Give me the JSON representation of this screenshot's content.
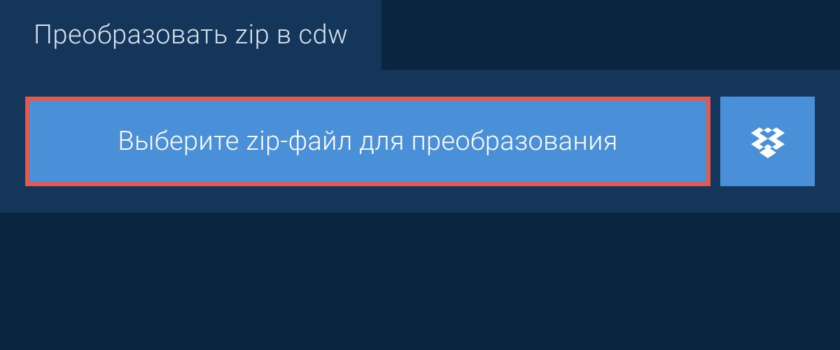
{
  "tab": {
    "title": "Преобразовать zip в cdw"
  },
  "upload": {
    "file_select_label": "Выберите zip-файл для преобразования"
  },
  "colors": {
    "background": "#0a2540",
    "panel": "#13365a",
    "button": "#4a90d9",
    "highlight_border": "#e05a4f"
  }
}
